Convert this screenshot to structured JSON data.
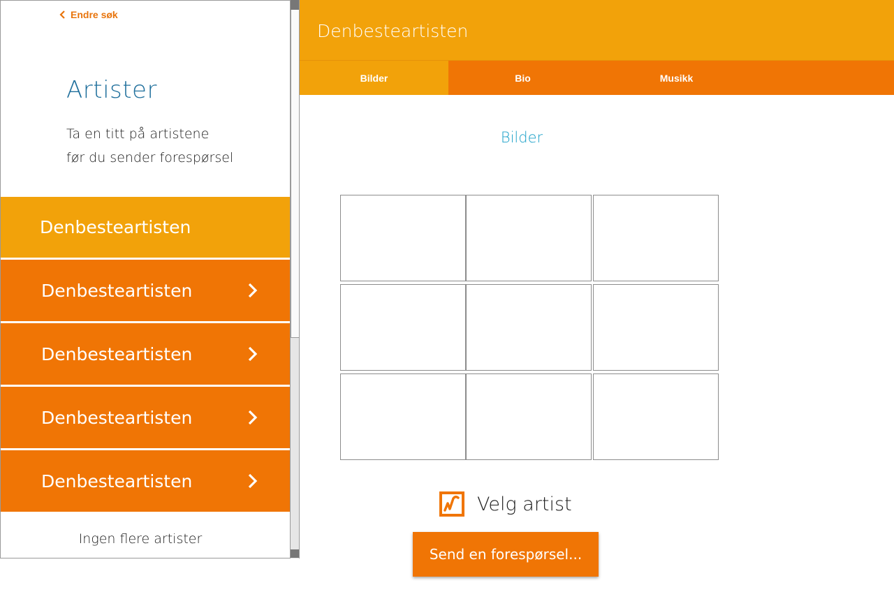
{
  "sidebar": {
    "back_label": "Endre søk",
    "title": "Artister",
    "subtitle_line1": "Ta en titt på artistene",
    "subtitle_line2": "før du sender forespørsel",
    "items": [
      {
        "label": "Denbesteartisten",
        "active": true
      },
      {
        "label": "Denbesteartisten",
        "active": false
      },
      {
        "label": "Denbesteartisten",
        "active": false
      },
      {
        "label": "Denbesteartisten",
        "active": false
      },
      {
        "label": "Denbesteartisten",
        "active": false
      }
    ],
    "footer": "Ingen flere artister"
  },
  "main": {
    "title": "Denbesteartisten",
    "tabs": [
      {
        "label": "Bilder",
        "active": true
      },
      {
        "label": "Bio",
        "active": false
      },
      {
        "label": "Musikk",
        "active": false
      }
    ],
    "section_title": "Bilder",
    "image_count": 9,
    "select_label": "Velg artist",
    "send_button": "Send en forespørsel..."
  },
  "colors": {
    "primary_orange": "#f07505",
    "light_orange": "#f2a20a",
    "title_blue": "#1f6f9c",
    "section_blue": "#1aa0c8"
  }
}
